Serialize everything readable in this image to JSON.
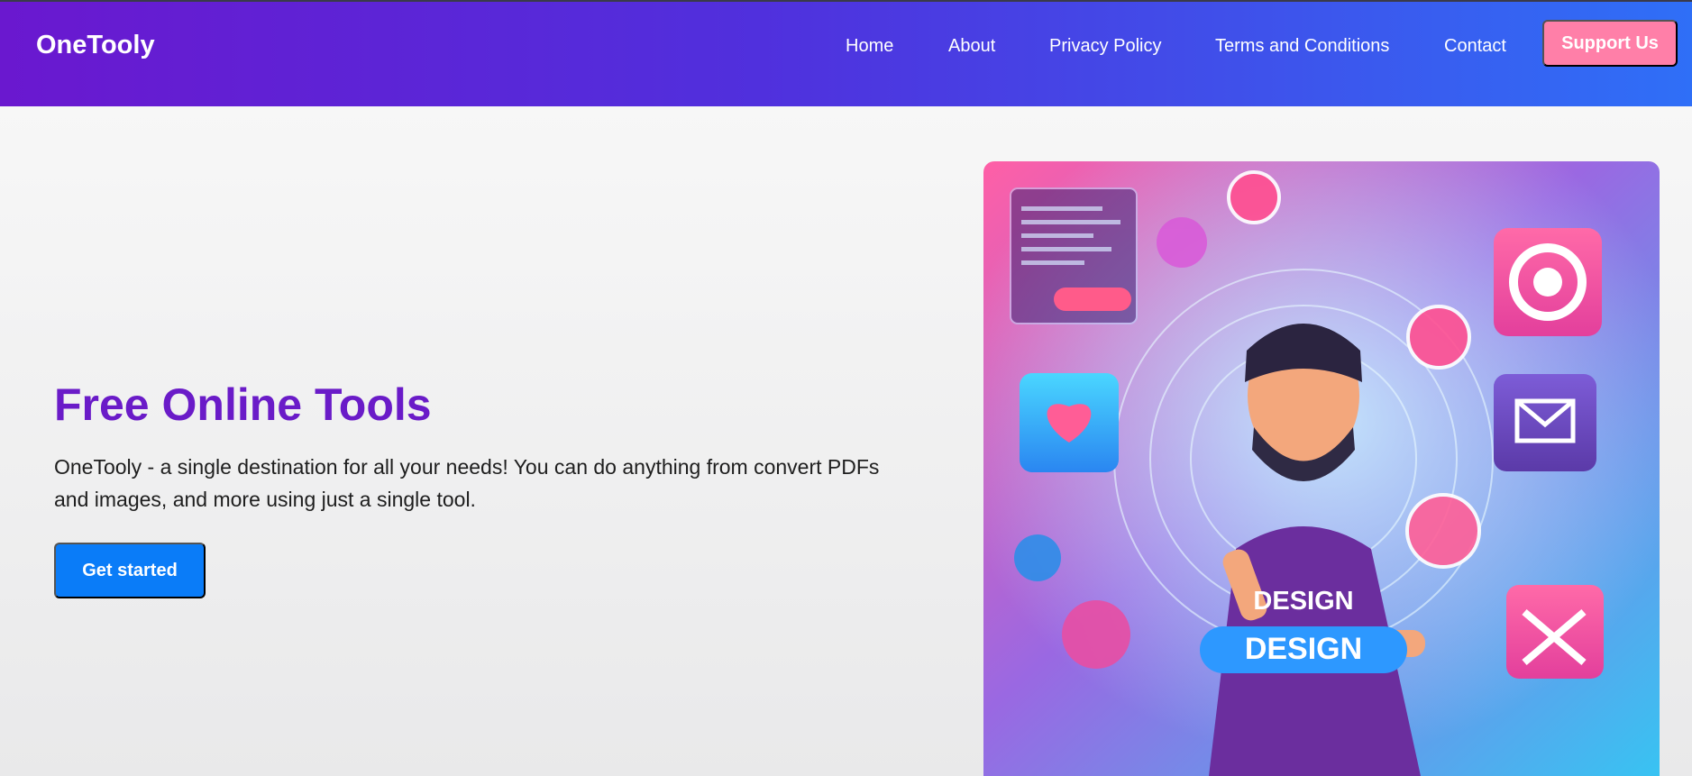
{
  "header": {
    "logo": "OneTooly",
    "nav": [
      "Home",
      "About",
      "Privacy Policy",
      "Terms and Conditions",
      "Contact"
    ],
    "support_label": "Support Us"
  },
  "hero": {
    "title": "Free Online Tools",
    "description": "OneTooly - a single destination for all your needs! You can do anything from convert PDFs and images, and more using just a single tool.",
    "cta_label": "Get started",
    "image_text_top": "DESIGN",
    "image_text_bottom": "DESIGN"
  },
  "colors": {
    "header_start": "#6a18cf",
    "header_end": "#2f6ff7",
    "title": "#6a1bc8",
    "cta": "#0a7cf8",
    "support": "#ff7fa8"
  }
}
